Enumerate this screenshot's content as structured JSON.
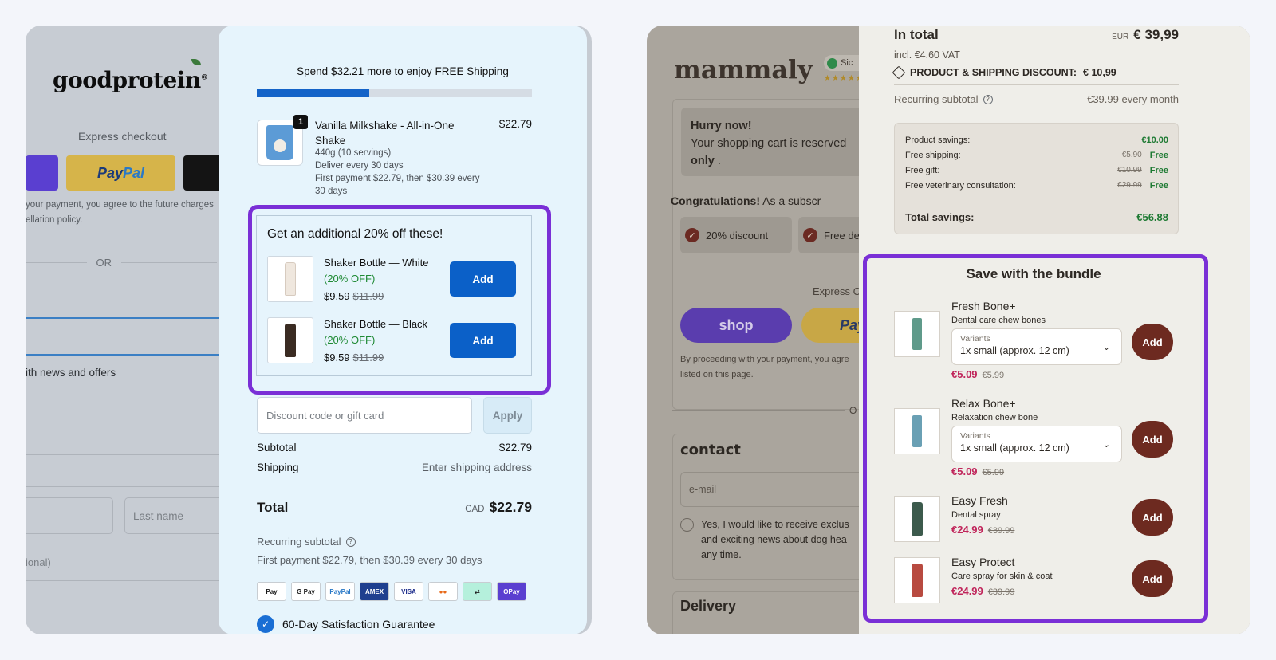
{
  "left": {
    "brand": "goodprotein",
    "brand_mark": "®",
    "express_checkout": "Express checkout",
    "paypal_a": "Pay",
    "paypal_b": "Pal",
    "fine_print_1": "your payment, you agree to the future charges",
    "fine_print_2": "ellation policy.",
    "or": "OR",
    "news_offers": "ith news and offers",
    "last_name_placeholder": "Last name",
    "optional": "ional)",
    "cart": {
      "shipping_message": "Spend $32.21 more to enjoy FREE Shipping",
      "shipping_progress_pct": 41,
      "product": {
        "qty": "1",
        "name": "Vanilla Milkshake - All-in-One Shake",
        "price": "$22.79",
        "servings": "440g (10 servings)",
        "delivery": "Deliver every 30 days",
        "payment_note": "First payment $22.79, then $30.39 every 30 days"
      },
      "upsell": {
        "title": "Get an additional 20% off these!",
        "items": [
          {
            "name": "Shaker Bottle — White",
            "off": "(20% OFF)",
            "price": "$9.59",
            "was": "$11.99",
            "add": "Add"
          },
          {
            "name": "Shaker Bottle — Black",
            "off": "(20% OFF)",
            "price": "$9.59",
            "was": "$11.99",
            "add": "Add"
          }
        ]
      },
      "discount_placeholder": "Discount code or gift card",
      "apply": "Apply",
      "subtotal_label": "Subtotal",
      "subtotal_value": "$22.79",
      "shipping_label": "Shipping",
      "shipping_value": "Enter shipping address",
      "total_label": "Total",
      "total_currency": "CAD",
      "total_value": "$22.79",
      "recurring_label": "Recurring subtotal",
      "first_payment": "First payment $22.79, then $30.39 every 30 days",
      "payment_icons": [
        "Pay",
        "G Pay",
        "PayPal",
        "AMEX",
        "VISA",
        "●●",
        "⇄",
        "OPay"
      ],
      "guarantee": "60-Day Satisfaction Guarantee"
    }
  },
  "right": {
    "brand": "mammaly",
    "badge": "Sic",
    "stars": "★★★★★",
    "hurry_title": "Hurry now!",
    "hurry_text": "Your shopping cart is reserved",
    "hurry_only": "only",
    "congrats_bold": "Congratulations!",
    "congrats_rest": "As a subscr",
    "chip_1": "20% discount",
    "chip_2": "Free de",
    "express": "Express C",
    "shop": "shop",
    "pay": "Pay",
    "fine_1": "By proceeding with your payment, you agre",
    "fine_2": "listed on this page.",
    "or": "O",
    "contact": "contact",
    "email_placeholder": "e-mail",
    "newsletter": "Yes, I would like to receive exclus and exciting news about dog hea any time.",
    "delivery": "Delivery",
    "summary": {
      "in_total": "In total",
      "currency": "EUR",
      "total": "€ 39,99",
      "vat": "incl. €4.60 VAT",
      "discount_label": "PRODUCT & SHIPPING DISCOUNT:",
      "discount_value": "€ 10,99",
      "recurring_label": "Recurring subtotal",
      "recurring_value": "€39.99 every month",
      "savings": [
        {
          "label": "Product savings:",
          "was": "",
          "value": "€10.00"
        },
        {
          "label": "Free shipping:",
          "was": "€5.90",
          "value": "Free"
        },
        {
          "label": "Free gift:",
          "was": "€10.99",
          "value": "Free"
        },
        {
          "label": "Free veterinary consultation:",
          "was": "€29.99",
          "value": "Free"
        }
      ],
      "total_savings_label": "Total savings:",
      "total_savings_value": "€56.88"
    },
    "bundle": {
      "title": "Save with the bundle",
      "variants_label": "Variants",
      "add": "Add",
      "items": [
        {
          "name": "Fresh Bone+",
          "desc": "Dental care chew bones",
          "variant": "1x small (approx. 12 cm)",
          "price": "€5.09",
          "was": "€5.99"
        },
        {
          "name": "Relax Bone+",
          "desc": "Relaxation chew bone",
          "variant": "1x small (approx. 12 cm)",
          "price": "€5.09",
          "was": "€5.99"
        },
        {
          "name": "Easy Fresh",
          "desc": "Dental spray",
          "variant": "",
          "price": "€24.99",
          "was": "€39.99"
        },
        {
          "name": "Easy Protect",
          "desc": "Care spray for skin & coat",
          "variant": "",
          "price": "€24.99",
          "was": "€39.99"
        }
      ]
    }
  }
}
